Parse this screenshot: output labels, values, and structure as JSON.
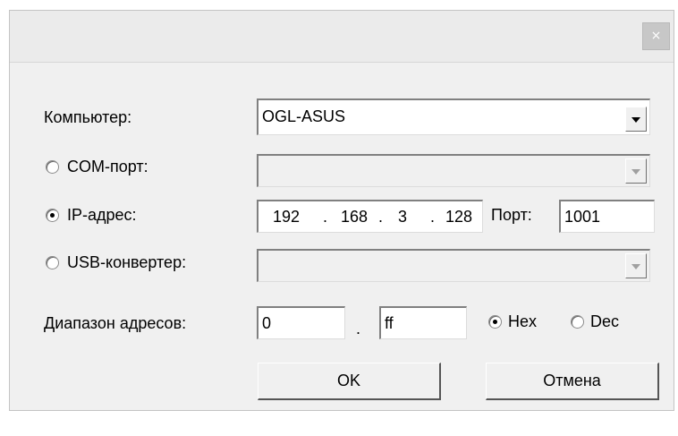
{
  "titlebar": {
    "close_label": "×"
  },
  "computer": {
    "label": "Компьютер:",
    "value": "OGL-ASUS"
  },
  "com_port": {
    "label": "COM-порт:",
    "value": "",
    "selected": false
  },
  "ip": {
    "label": "IP-адрес:",
    "selected": true,
    "octet1": "192",
    "octet2": "168",
    "octet3": "3",
    "octet4": "128",
    "sep": ".",
    "port_label": "Порт:",
    "port_value": "1001"
  },
  "usb": {
    "label": "USB-конвертер:",
    "value": "",
    "selected": false
  },
  "range": {
    "label": "Диапазон адресов:",
    "from": "0",
    "sep": ".",
    "to": "ff",
    "hex_label": "Hex",
    "dec_label": "Dec",
    "mode": "Hex"
  },
  "buttons": {
    "ok": "OK",
    "cancel": "Отмена"
  }
}
